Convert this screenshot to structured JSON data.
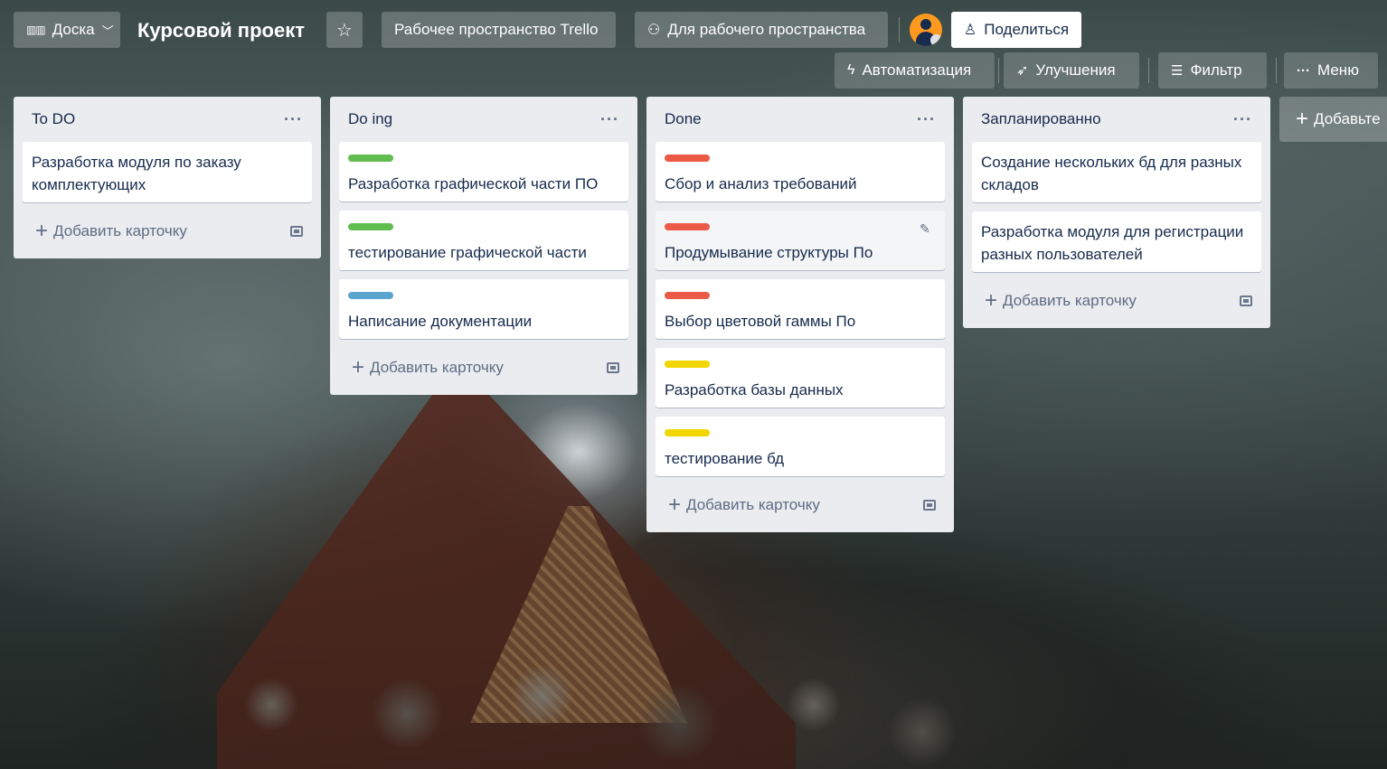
{
  "header": {
    "view_switcher": "Доска",
    "board_title": "Курсовой проект",
    "workspace": "Рабочее пространство Trello",
    "visibility": "Для рабочего пространства",
    "share": "Поделиться",
    "automation": "Автоматизация",
    "powerups": "Улучшения",
    "filter": "Фильтр",
    "menu": "Меню"
  },
  "colors": {
    "green": "#61bd4f",
    "red": "#eb5a46",
    "blue": "#5ba4cf",
    "yellow": "#f2d600"
  },
  "lists": [
    {
      "title": "To DO",
      "cards": [
        {
          "text": "Разработка модуля по заказу комплектующих"
        }
      ],
      "add_card": "Добавить карточку"
    },
    {
      "title": "Do ing",
      "cards": [
        {
          "text": "Разработка графической части ПО",
          "label": "green"
        },
        {
          "text": "тестирование графической части",
          "label": "green"
        },
        {
          "text": "Написание документации",
          "label": "blue"
        }
      ],
      "add_card": "Добавить карточку"
    },
    {
      "title": "Done",
      "cards": [
        {
          "text": "Сбор и анализ требований",
          "label": "red"
        },
        {
          "text": "Продумывание структуры По",
          "label": "red"
        },
        {
          "text": "Выбор цветовой гаммы По",
          "label": "red"
        },
        {
          "text": "Разработка базы данных",
          "label": "yellow"
        },
        {
          "text": "тестирование бд",
          "label": "yellow"
        }
      ],
      "add_card": "Добавить карточку"
    },
    {
      "title": "Запланированно",
      "cards": [
        {
          "text": "Создание нескольких бд для разных складов"
        },
        {
          "text": "Разработка модуля для регистрации разных пользователей"
        }
      ],
      "add_card": "Добавить карточку"
    }
  ],
  "add_list": "Добавьте"
}
